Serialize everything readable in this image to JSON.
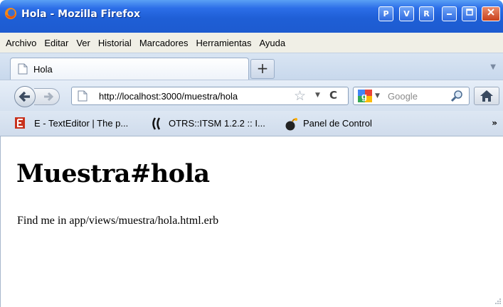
{
  "window": {
    "title": "Hola - Mozilla Firefox",
    "buttons": [
      "P",
      "V",
      "R"
    ]
  },
  "menu": [
    "Archivo",
    "Editar",
    "Ver",
    "Historial",
    "Marcadores",
    "Herramientas",
    "Ayuda"
  ],
  "tabs": [
    {
      "label": "Hola"
    }
  ],
  "navbar": {
    "url": "http://localhost:3000/muestra/hola",
    "search_placeholder": "Google"
  },
  "bookmarks": [
    {
      "label": "E - TextEditor | The p...",
      "icon": "textmate-e-icon"
    },
    {
      "label": "OTRS::ITSM 1.2.2 :: I...",
      "icon": "otrs-icon"
    },
    {
      "label": "Panel de Control",
      "icon": "bomb-icon"
    }
  ],
  "page": {
    "heading": "Muestra#hola",
    "text": "Find me in app/views/muestra/hola.html.erb"
  }
}
